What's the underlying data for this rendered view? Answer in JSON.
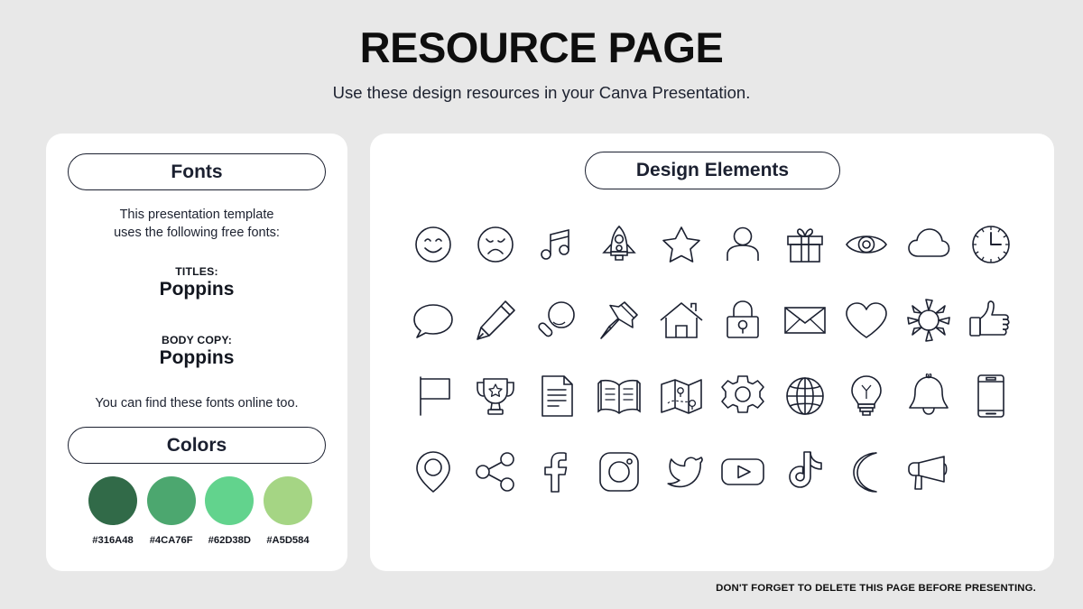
{
  "header": {
    "title": "RESOURCE PAGE",
    "subtitle": "Use these design resources in your Canva Presentation."
  },
  "fonts_panel": {
    "heading": "Fonts",
    "description": "This presentation template\nuses the following free fonts:",
    "description_line1": "This presentation template",
    "description_line2": "uses the following free fonts:",
    "titles_label": "TITLES:",
    "titles_font": "Poppins",
    "body_label": "BODY COPY:",
    "body_font": "Poppins",
    "note": "You can find these fonts online too."
  },
  "colors_panel": {
    "heading": "Colors",
    "swatches": [
      {
        "hex": "#316A48",
        "label": "#316A48"
      },
      {
        "hex": "#4CA76F",
        "label": "#4CA76F"
      },
      {
        "hex": "#62D38D",
        "label": "#62D38D"
      },
      {
        "hex": "#A5D584",
        "label": "#A5D584"
      }
    ]
  },
  "elements_panel": {
    "heading": "Design Elements",
    "icons": [
      "smiley-face-icon",
      "sad-face-icon",
      "music-note-icon",
      "rocket-icon",
      "star-icon",
      "person-icon",
      "gift-icon",
      "eye-icon",
      "cloud-icon",
      "clock-icon",
      "speech-bubble-icon",
      "pencil-icon",
      "magnifier-icon",
      "push-pin-icon",
      "house-icon",
      "lock-icon",
      "envelope-icon",
      "heart-icon",
      "sun-icon",
      "thumbs-up-icon",
      "flag-icon",
      "trophy-icon",
      "document-icon",
      "open-book-icon",
      "map-icon",
      "gear-icon",
      "globe-icon",
      "lightbulb-icon",
      "bell-icon",
      "phone-icon",
      "location-pin-icon",
      "share-icon",
      "facebook-icon",
      "instagram-icon",
      "twitter-icon",
      "youtube-icon",
      "tiktok-icon",
      "moon-icon",
      "megaphone-icon"
    ]
  },
  "footer": {
    "note": "DON'T FORGET TO DELETE THIS PAGE BEFORE PRESENTING."
  },
  "theme": {
    "background": "#E8E8E8",
    "card_background": "#FFFFFF",
    "ink": "#1B2030"
  }
}
